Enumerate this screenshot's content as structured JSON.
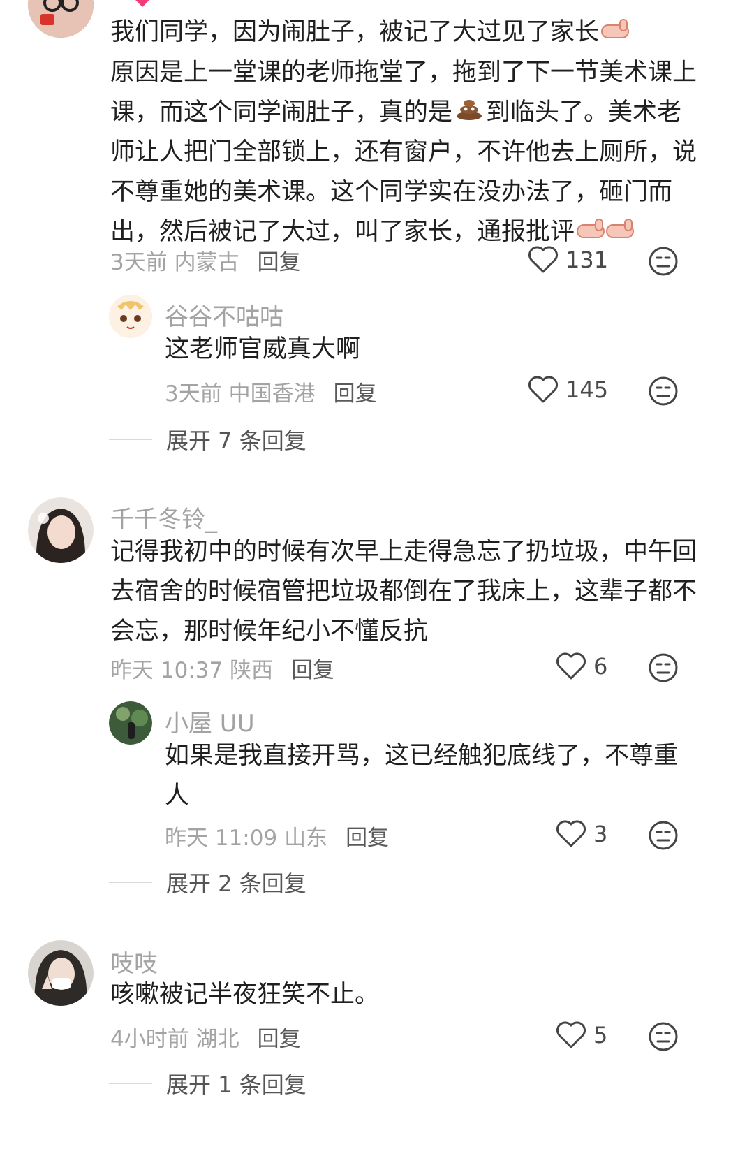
{
  "comments": [
    {
      "username": "",
      "text_lines": [
        "我们同学，因为闹肚子，被记了大过见了家长",
        "原因是上一堂课的老师拖堂了，拖到了下一节美术课上",
        "课，而这个同学闹肚子，真的是",
        "到临头了。美术老",
        "师让人把门全部锁上，还有窗户，不许他去上厕所，说",
        "不尊重她的美术课。这个同学实在没办法了，砸门而",
        "出，然后被记了大过，叫了家长，通报批评"
      ],
      "time": "3天前",
      "location": "内蒙古",
      "reply_label": "回复",
      "likes": "131",
      "replies": [
        {
          "username": "谷谷不咕咕",
          "text": "这老师官威真大啊",
          "time": "3天前",
          "location": "中国香港",
          "reply_label": "回复",
          "likes": "145"
        }
      ],
      "expand_label": "展开 7 条回复"
    },
    {
      "username": "千千冬铃_",
      "text_lines": [
        "记得我初中的时候有次早上走得急忘了扔垃圾，中午回",
        "去宿舍的时候宿管把垃圾都倒在了我床上，这辈子都不",
        "会忘，那时候年纪小不懂反抗"
      ],
      "time": "昨天 10:37",
      "location": "陕西",
      "reply_label": "回复",
      "likes": "6",
      "replies": [
        {
          "username": "小屋 UU",
          "text_lines": [
            "如果是我直接开骂，这已经触犯底线了，不尊重",
            "人"
          ],
          "time": "昨天 11:09",
          "location": "山东",
          "reply_label": "回复",
          "likes": "3"
        }
      ],
      "expand_label": "展开 2 条回复"
    },
    {
      "username": "吱吱",
      "text": "咳嗽被记半夜狂笑不止。",
      "time": "4小时前",
      "location": "湖北",
      "reply_label": "回复",
      "likes": "5",
      "expand_label": "展开 1 条回复"
    }
  ],
  "colors": {
    "meta": "#a3a3a3",
    "text": "#1f1f1f",
    "divider": "#d9d9d9"
  }
}
